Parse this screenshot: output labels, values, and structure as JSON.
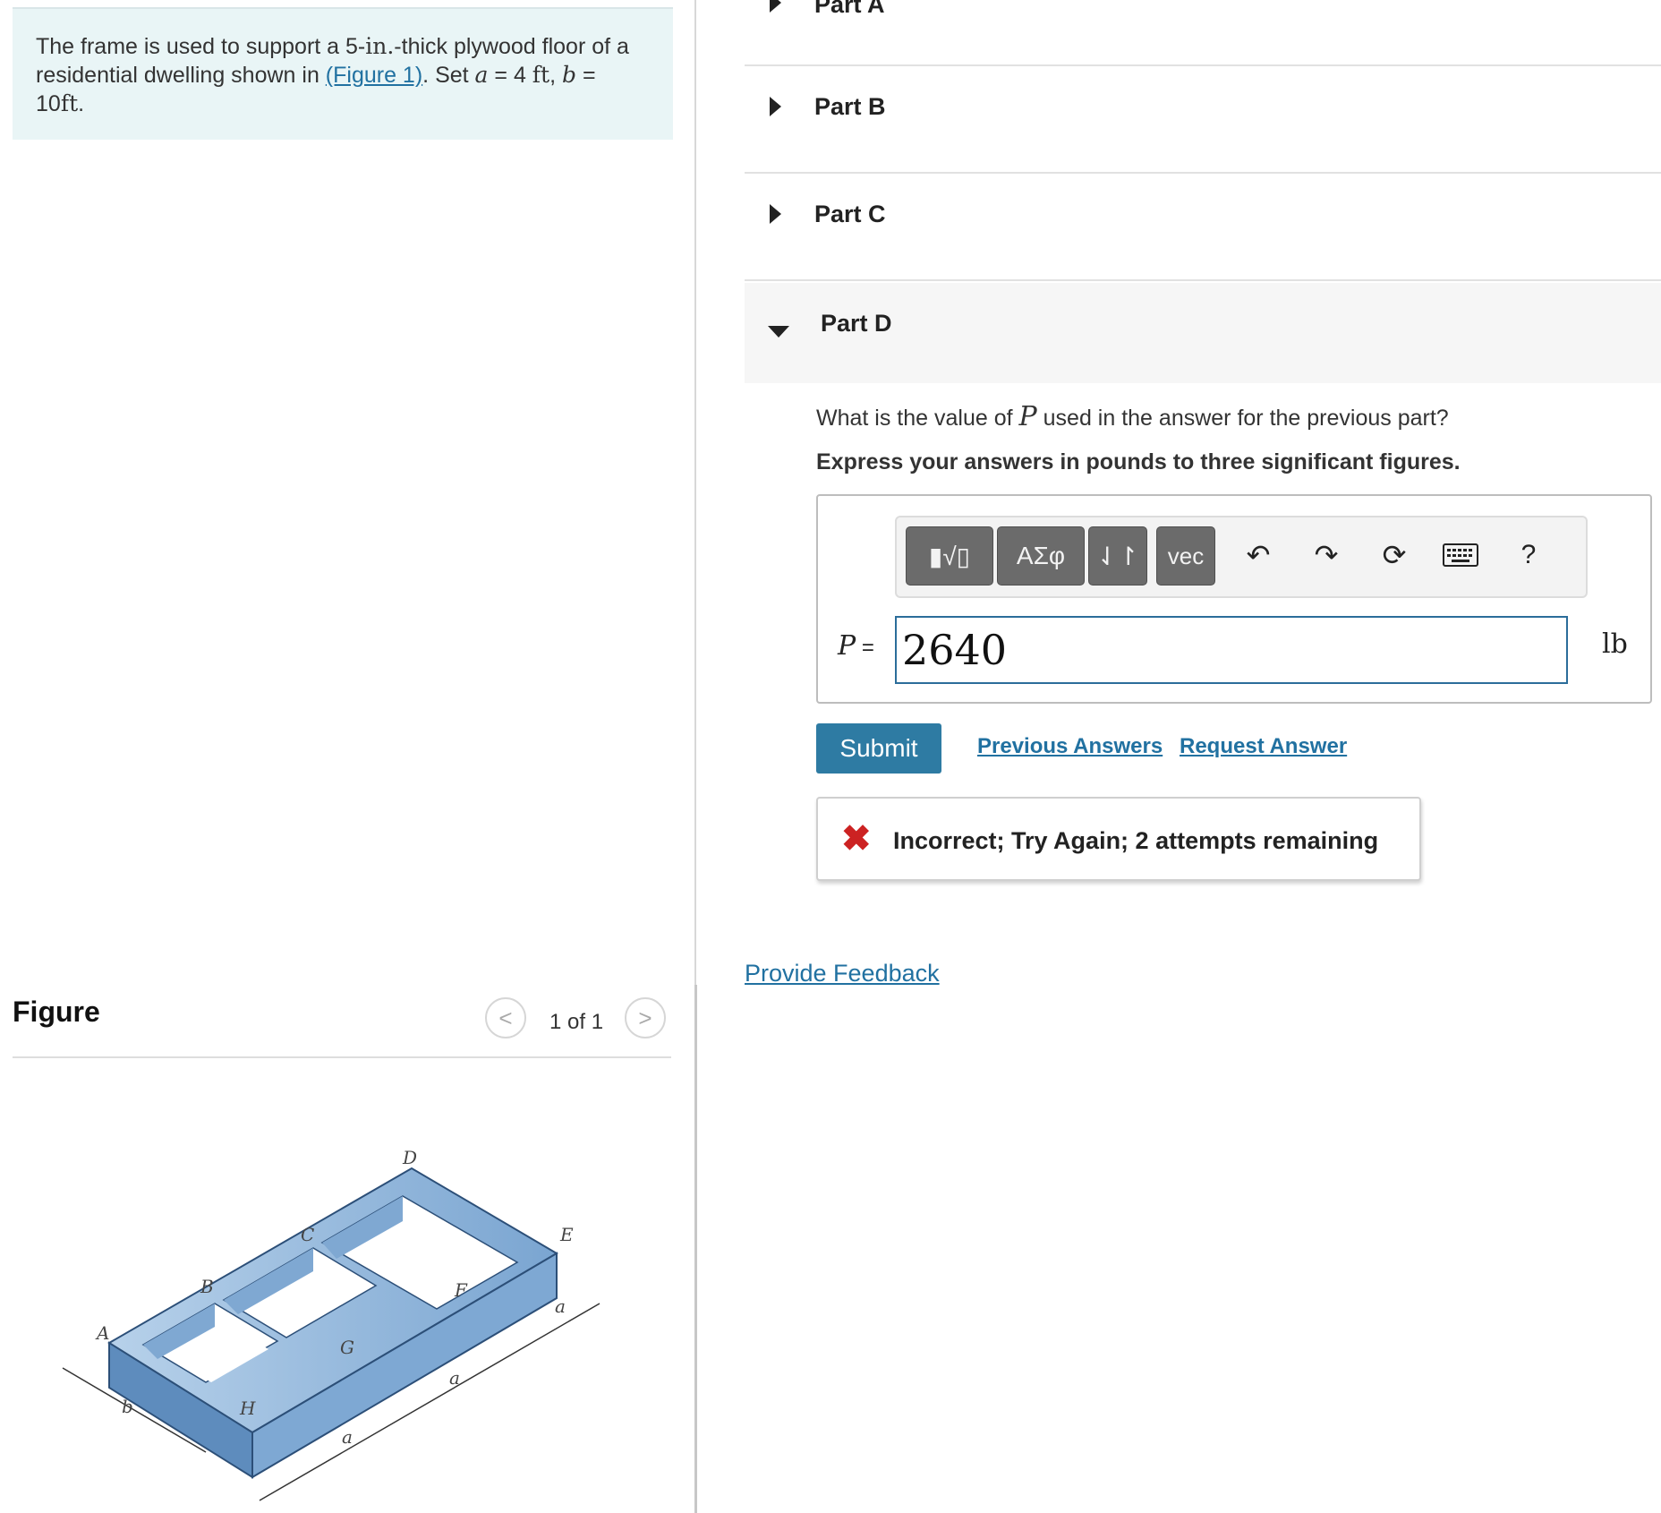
{
  "problem": {
    "text_1": "The frame is used to support a 5-",
    "unit_in": "in.",
    "text_2": "-thick plywood floor of a residential dwelling shown in ",
    "figure_link": "(Figure 1)",
    "text_3": ". Set ",
    "var_a": "a",
    "eq_a": " = 4 ",
    "unit_ft_a": "ft",
    "sep": ", ",
    "var_b": "b",
    "eq_b": " = 10",
    "unit_ft_b": "ft",
    "end": "."
  },
  "figure_panel": {
    "title": "Figure",
    "count": "1 of 1",
    "prev": "<",
    "next": ">",
    "labels": {
      "A": "A",
      "B": "B",
      "C": "C",
      "D": "D",
      "E": "E",
      "F": "F",
      "G": "G",
      "H": "H",
      "a": "a",
      "b": "b"
    }
  },
  "parts": {
    "part_a": "Part A",
    "part_b": "Part B",
    "part_c": "Part C",
    "part_d": "Part D"
  },
  "question": {
    "text_1": "What is the value of ",
    "var": "P",
    "text_2": " used in the answer for the previous part?",
    "instruction": "Express your answers in pounds to three significant figures."
  },
  "toolbar": {
    "templates": "▮√▯",
    "greek": "ΑΣφ",
    "arrows": "⇃↾",
    "vec": "vec",
    "help": "?"
  },
  "answer": {
    "label_var": "P",
    "label_eq": " =",
    "value": "2640",
    "unit": "lb"
  },
  "actions": {
    "submit": "Submit",
    "previous_answers": "Previous Answers",
    "request_answer": "Request Answer"
  },
  "feedback": {
    "icon": "✖",
    "text": "Incorrect; Try Again; 2 attempts remaining"
  },
  "provide_feedback": "Provide Feedback",
  "colors": {
    "link": "#2171a1",
    "submit": "#2e7ba3",
    "problem_bg": "#e9f5f6",
    "error": "#cc2222",
    "frame_blue": "#6f9cc8"
  }
}
